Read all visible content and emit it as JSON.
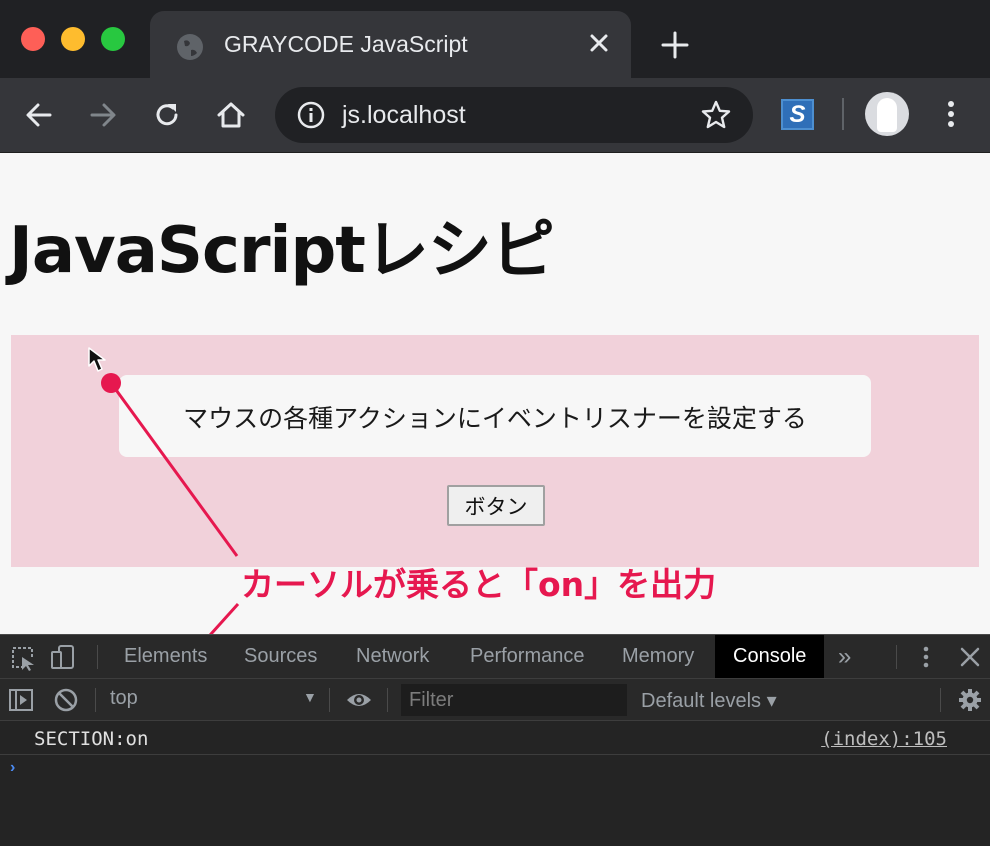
{
  "browser": {
    "tab_title": "GRAYCODE JavaScript",
    "url": "js.localhost",
    "extension_letter": "S",
    "icons": {
      "window_controls": [
        "close",
        "minimize",
        "maximize"
      ],
      "toolbar": [
        "back-arrow-icon",
        "forward-arrow-icon",
        "reload-icon",
        "home-icon",
        "info-icon",
        "star-icon",
        "avatar",
        "kebab-menu-icon"
      ]
    }
  },
  "page": {
    "title": "JavaScriptレシピ",
    "description": "マウスの各種アクションにイベントリスナーを設定する",
    "button_label": "ボタン",
    "section_bg": "#f1d1da"
  },
  "annotation": {
    "text": "カーソルが乗ると「on」を出力",
    "color": "#e6184f"
  },
  "devtools": {
    "tabs": [
      "Elements",
      "Sources",
      "Network",
      "Performance",
      "Memory",
      "Console"
    ],
    "active_tab": "Console",
    "more_tabs": "»",
    "context": "top",
    "filter_placeholder": "Filter",
    "levels": "Default levels ▾",
    "log": {
      "message": "SECTION:on",
      "source": "(index):105"
    },
    "prompt": "›"
  }
}
